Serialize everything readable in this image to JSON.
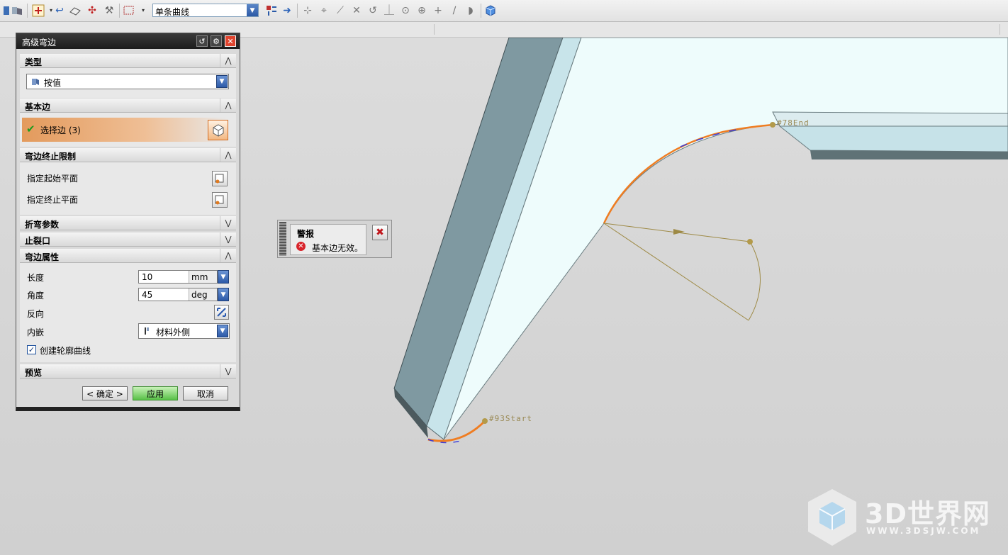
{
  "toolbar": {
    "filter_value": "单条曲线"
  },
  "dialog": {
    "title": "高级弯边",
    "sections": {
      "type": {
        "label": "类型",
        "value": "按值"
      },
      "base_edge": {
        "label": "基本边",
        "select_label": "选择边 (3)"
      },
      "flange_limit": {
        "label": "弯边终止限制",
        "start_plane": "指定起始平面",
        "end_plane": "指定终止平面"
      },
      "bend_params": {
        "label": "折弯参数"
      },
      "relief": {
        "label": "止裂口"
      },
      "properties": {
        "label": "弯边属性",
        "length_label": "长度",
        "length_value": "10",
        "length_unit": "mm",
        "angle_label": "角度",
        "angle_value": "45",
        "angle_unit": "deg",
        "reverse_label": "反向",
        "inset_label": "内嵌",
        "inset_value": "材料外侧",
        "create_profile_label": "创建轮廓曲线",
        "create_profile_checked": true
      },
      "preview": {
        "label": "预览"
      }
    },
    "buttons": {
      "ok": "< 确定 >",
      "apply": "应用",
      "cancel": "取消"
    }
  },
  "alert": {
    "title": "警报",
    "message": "基本边无效。"
  },
  "viewport": {
    "end_tag": "#78End",
    "start_tag": "#93Start"
  },
  "watermark": {
    "title": "3D世界网",
    "url": "WWW.3DSJW.COM"
  }
}
